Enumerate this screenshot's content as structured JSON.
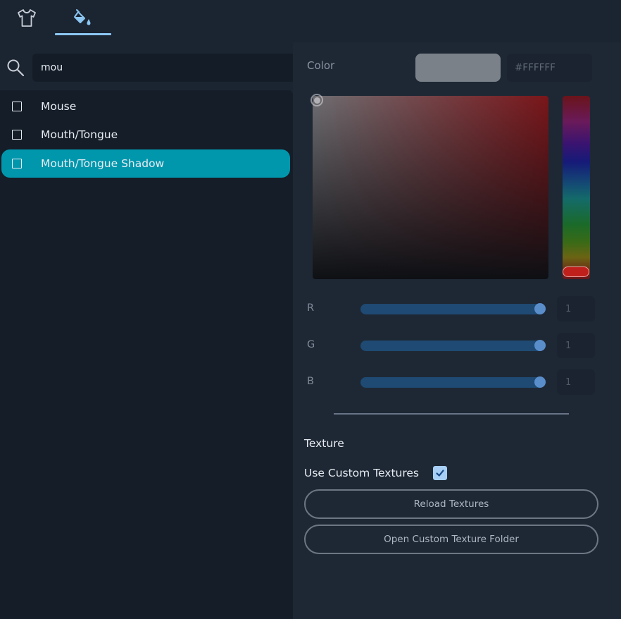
{
  "tabs": [
    {
      "icon": "shirt-icon",
      "active": false
    },
    {
      "icon": "paint-bucket-icon",
      "active": true
    }
  ],
  "search": {
    "value": "mou",
    "icon": "search-icon"
  },
  "list": {
    "items": [
      {
        "label": "Mouse",
        "checked": false,
        "selected": false
      },
      {
        "label": "Mouth/Tongue",
        "checked": false,
        "selected": false
      },
      {
        "label": "Mouth/Tongue Shadow",
        "checked": false,
        "selected": true
      }
    ]
  },
  "color": {
    "label": "Color",
    "hex": "#FFFFFF",
    "swatch_color": "#7b8189"
  },
  "sliders": [
    {
      "label": "R",
      "value": "1",
      "fraction": 1
    },
    {
      "label": "G",
      "value": "1",
      "fraction": 1
    },
    {
      "label": "B",
      "value": "1",
      "fraction": 1
    }
  ],
  "texture": {
    "heading": "Texture",
    "use_custom_label": "Use Custom Textures",
    "use_custom_checked": true,
    "reload_button": "Reload Textures",
    "open_folder_button": "Open Custom Texture Folder"
  },
  "colors": {
    "accent": "#0097ad",
    "tab_underline": "#8cc6f2",
    "slider_track": "#1e4a73",
    "slider_knob": "#5a8ecb",
    "check_fill": "#a7cff5"
  }
}
